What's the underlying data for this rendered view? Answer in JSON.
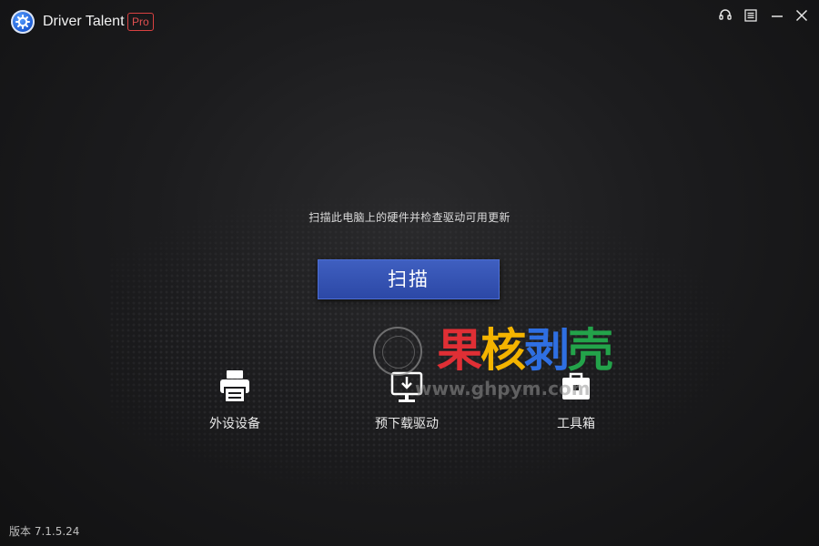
{
  "app": {
    "title": "Driver Talent",
    "badge": "Pro",
    "logo_icon": "gear-icon"
  },
  "window_controls": [
    {
      "name": "support-headset-icon",
      "label": "support"
    },
    {
      "name": "menu-icon",
      "label": "menu"
    },
    {
      "name": "minimize-icon",
      "label": "minimize"
    },
    {
      "name": "close-icon",
      "label": "close"
    }
  ],
  "main": {
    "hint_text": "扫描此电脑上的硬件并检查驱动可用更新",
    "scan_button_label": "扫描"
  },
  "features": [
    {
      "label": "外设设备",
      "icon": "printer-icon"
    },
    {
      "label": "预下载驱动",
      "icon": "monitor-download-icon"
    },
    {
      "label": "工具箱",
      "icon": "toolbox-icon"
    }
  ],
  "footer": {
    "version_text": "版本 7.1.5.24"
  },
  "watermark": {
    "chars": [
      "果",
      "核",
      "剥",
      "壳"
    ],
    "url": "www.ghpym.com"
  },
  "colors": {
    "scan_button": "#3452b4",
    "pro_badge": "#e05050",
    "watermark_red": "#e02f35",
    "watermark_yellow": "#f4b400",
    "watermark_blue": "#2f6fe2",
    "watermark_green": "#23a34a"
  }
}
